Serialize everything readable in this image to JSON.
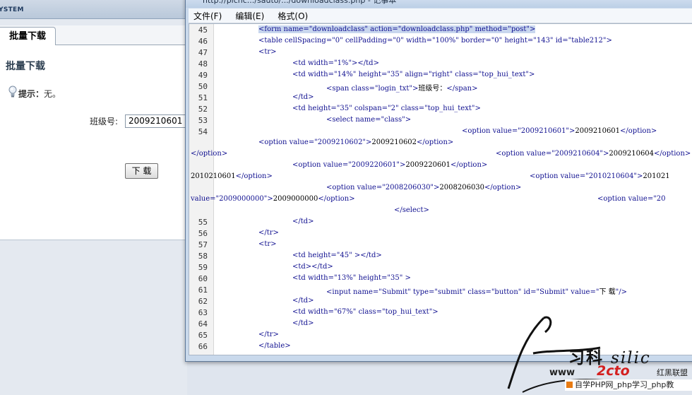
{
  "left_page": {
    "system_label": "YSTEM",
    "tab_label": "批量下载",
    "page_title": "批量下载",
    "tip_label": "提示：",
    "tip_value": "无。",
    "class_label": "班级号:",
    "class_value": "2009210601",
    "download_button": "下 载"
  },
  "notepad": {
    "title": "http://plcnc.../sauto/.../downloadclass.php - 记事本",
    "menu": [
      "文件(F)",
      "编辑(E)",
      "格式(O)"
    ],
    "lines": [
      {
        "n": "45",
        "segs": [
          {
            "t": "<form name=\"downloadclass\" action=\"downloadclass.php\" method=\"post\">",
            "k": "tag"
          }
        ],
        "selected": true
      },
      {
        "n": "46",
        "segs": [
          {
            "t": "<table cellSpacing=\"0\" cellPadding=\"0\" width=\"100%\" border=\"0\" height=\"143\" id=\"table212\">",
            "k": "tag"
          }
        ]
      },
      {
        "n": "47",
        "segs": [
          {
            "t": "<tr>",
            "k": "tag"
          }
        ]
      },
      {
        "n": "48",
        "segs": [
          {
            "t": "<td width=\"1%\"></td>",
            "k": "tag"
          }
        ]
      },
      {
        "n": "49",
        "segs": [
          {
            "t": "<td width=\"14%\" height=\"35\" align=\"right\" class=\"top_hui_text\">",
            "k": "tag"
          }
        ]
      },
      {
        "n": "50",
        "segs": [
          {
            "t": "<span class=\"login_txt\">",
            "k": "tag"
          },
          {
            "t": "班级号：",
            "k": "txt"
          },
          {
            "t": "</span>",
            "k": "tag"
          }
        ]
      },
      {
        "n": "51",
        "segs": [
          {
            "t": "</td>",
            "k": "tag"
          }
        ]
      },
      {
        "n": "52",
        "segs": [
          {
            "t": "<td height=\"35\" colspan=\"2\" class=\"top_hui_text\">",
            "k": "tag"
          }
        ]
      },
      {
        "n": "53",
        "segs": [
          {
            "t": "<select name=\"class\">",
            "k": "tag"
          }
        ]
      },
      {
        "n": "54",
        "segs": [
          {
            "t": "<option value=\"2009210601\">",
            "k": "tag"
          },
          {
            "t": "2009210601",
            "k": "txt"
          },
          {
            "t": "</option>",
            "k": "tag"
          }
        ]
      },
      {
        "n": "",
        "segs": [
          {
            "t": "<option value=\"2009210602\">",
            "k": "tag"
          },
          {
            "t": "2009210602",
            "k": "txt"
          },
          {
            "t": "</option>",
            "k": "tag"
          }
        ]
      },
      {
        "n": "",
        "segs": [
          {
            "t": "</option>",
            "k": "tag"
          }
        ]
      },
      {
        "n": "",
        "segs": [
          {
            "t": "<option value=\"2009210604\">",
            "k": "tag"
          },
          {
            "t": "2009210604",
            "k": "txt"
          },
          {
            "t": "</option>",
            "k": "tag"
          }
        ]
      },
      {
        "n": "",
        "segs": [
          {
            "t": "<option value=\"2009220601\">",
            "k": "tag"
          },
          {
            "t": "2009220601",
            "k": "txt"
          },
          {
            "t": "</option>",
            "k": "tag"
          }
        ]
      },
      {
        "n": "",
        "segs": [
          {
            "t": "2010210601",
            "k": "txt"
          },
          {
            "t": "</option>",
            "k": "tag"
          }
        ]
      },
      {
        "n": "",
        "segs": [
          {
            "t": "<option value=\"2010210604\">",
            "k": "tag"
          },
          {
            "t": "201021",
            "k": "txt"
          }
        ]
      },
      {
        "n": "",
        "segs": [
          {
            "t": "<option value=\"2008206030\">",
            "k": "tag"
          },
          {
            "t": "2008206030",
            "k": "txt"
          },
          {
            "t": "</option>",
            "k": "tag"
          }
        ]
      },
      {
        "n": "",
        "segs": [
          {
            "t": "value=\"2009000000\">",
            "k": "tag"
          },
          {
            "t": "2009000000",
            "k": "txt"
          },
          {
            "t": "</option>",
            "k": "tag"
          }
        ]
      },
      {
        "n": "",
        "segs": [
          {
            "t": "<option value=\"20",
            "k": "tag"
          }
        ]
      },
      {
        "n": "",
        "segs": [
          {
            "t": "</select>",
            "k": "tag"
          }
        ]
      },
      {
        "n": "55",
        "segs": [
          {
            "t": "</td>",
            "k": "tag"
          }
        ]
      },
      {
        "n": "56",
        "segs": [
          {
            "t": "</tr>",
            "k": "tag"
          }
        ]
      },
      {
        "n": "57",
        "segs": [
          {
            "t": "<tr>",
            "k": "tag"
          }
        ]
      },
      {
        "n": "58",
        "segs": [
          {
            "t": "<td height=\"45\" ></td>",
            "k": "tag"
          }
        ]
      },
      {
        "n": "59",
        "segs": [
          {
            "t": "<td></td>",
            "k": "tag"
          }
        ]
      },
      {
        "n": "60",
        "segs": [
          {
            "t": "<td width=\"13%\" height=\"35\" >",
            "k": "tag"
          }
        ]
      },
      {
        "n": "61",
        "segs": [
          {
            "t": "<input name=\"Submit\" type=\"submit\" class=\"button\" id=\"Submit\" value=\"",
            "k": "tag"
          },
          {
            "t": "下 载",
            "k": "txt"
          },
          {
            "t": "\"/>",
            "k": "tag"
          }
        ]
      },
      {
        "n": "62",
        "segs": [
          {
            "t": "</td>",
            "k": "tag"
          }
        ]
      },
      {
        "n": "63",
        "segs": [
          {
            "t": "<td width=\"67%\" class=\"top_hui_text\">",
            "k": "tag"
          }
        ]
      },
      {
        "n": "64",
        "segs": [
          {
            "t": "</td>",
            "k": "tag"
          }
        ]
      },
      {
        "n": "65",
        "segs": [
          {
            "t": "</tr>",
            "k": "tag"
          }
        ]
      },
      {
        "n": "66",
        "segs": [
          {
            "t": "</table>",
            "k": "tag"
          }
        ]
      }
    ]
  },
  "watermark": {
    "cn_text": "习科",
    "latin_text": "silic",
    "www": "www",
    "logo": "2cto",
    "red_text": "红黑联盟",
    "footer_text": "自学PHP网_php学习_php教"
  },
  "colors": {
    "code_tag": "#101090",
    "code_text": "#000000",
    "selection": "#c8d6ee",
    "logo_red": "#d42020"
  }
}
